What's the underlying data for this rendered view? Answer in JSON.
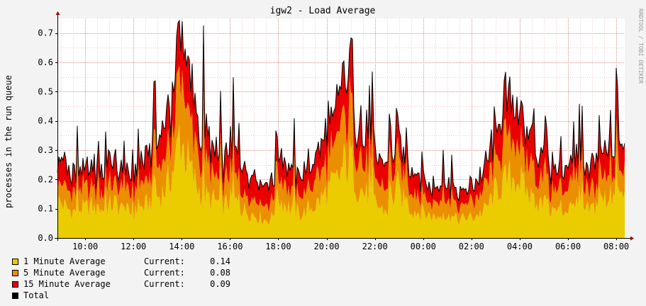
{
  "window": {
    "background": "#f3f3f3"
  },
  "chart_data": {
    "type": "area",
    "title": "igw2 - Load Average",
    "ylabel": "processes in the run queue",
    "xlabel": "",
    "watermark": "RRDTOOL / TOBI OETIKER",
    "ylim": [
      0,
      0.75
    ],
    "yticks": [
      "0.0",
      "0.1",
      "0.2",
      "0.3",
      "0.4",
      "0.5",
      "0.6",
      "0.7"
    ],
    "yticks_values": [
      0,
      0.1,
      0.2,
      0.3,
      0.4,
      0.5,
      0.6,
      0.7
    ],
    "xlim_hours": [
      8.85,
      32.35
    ],
    "xticks": [
      "10:00",
      "12:00",
      "14:00",
      "16:00",
      "18:00",
      "20:00",
      "22:00",
      "00:00",
      "02:00",
      "04:00",
      "06:00",
      "08:00"
    ],
    "xticks_hours": [
      10,
      12,
      14,
      16,
      18,
      20,
      22,
      24,
      26,
      28,
      30,
      32
    ],
    "grid": true,
    "legend_placement": "bottom-left",
    "x_hours": [
      8.85,
      9.0,
      9.25,
      9.5,
      9.75,
      10.0,
      10.25,
      10.5,
      10.75,
      11.0,
      11.25,
      11.5,
      11.75,
      12.0,
      12.25,
      12.5,
      12.75,
      13.0,
      13.25,
      13.5,
      13.75,
      13.9,
      14.0,
      14.25,
      14.5,
      14.75,
      15.0,
      15.25,
      15.5,
      15.75,
      16.0,
      16.25,
      16.5,
      16.75,
      17.0,
      17.25,
      17.5,
      17.75,
      18.0,
      18.25,
      18.5,
      18.75,
      19.0,
      19.25,
      19.5,
      19.75,
      20.0,
      20.25,
      20.5,
      20.75,
      20.9,
      21.0,
      21.25,
      21.5,
      21.75,
      22.0,
      22.25,
      22.5,
      22.75,
      22.9,
      23.0,
      23.25,
      23.5,
      23.75,
      24.0,
      24.25,
      24.5,
      24.75,
      25.0,
      25.25,
      25.5,
      25.75,
      26.0,
      26.25,
      26.5,
      26.75,
      27.0,
      27.25,
      27.5,
      27.75,
      28.0,
      28.25,
      28.5,
      28.75,
      29.0,
      29.25,
      29.5,
      29.75,
      30.0,
      30.25,
      30.5,
      30.75,
      31.0,
      31.25,
      31.5,
      31.75,
      32.0,
      32.25,
      32.35
    ],
    "series": [
      {
        "name": "1 Minute Average",
        "color": "#EACC00",
        "current": "0.14",
        "values": [
          0.13,
          0.12,
          0.1,
          0.09,
          0.1,
          0.1,
          0.11,
          0.09,
          0.1,
          0.11,
          0.12,
          0.1,
          0.09,
          0.08,
          0.1,
          0.11,
          0.13,
          0.14,
          0.16,
          0.2,
          0.26,
          0.36,
          0.33,
          0.26,
          0.2,
          0.16,
          0.14,
          0.13,
          0.12,
          0.11,
          0.13,
          0.12,
          0.1,
          0.09,
          0.08,
          0.07,
          0.06,
          0.07,
          0.14,
          0.12,
          0.1,
          0.09,
          0.08,
          0.1,
          0.11,
          0.13,
          0.16,
          0.18,
          0.2,
          0.26,
          0.25,
          0.28,
          0.18,
          0.16,
          0.14,
          0.12,
          0.1,
          0.09,
          0.12,
          0.2,
          0.15,
          0.12,
          0.1,
          0.09,
          0.08,
          0.08,
          0.07,
          0.08,
          0.07,
          0.07,
          0.06,
          0.07,
          0.07,
          0.08,
          0.09,
          0.12,
          0.16,
          0.18,
          0.2,
          0.21,
          0.2,
          0.16,
          0.14,
          0.12,
          0.11,
          0.1,
          0.09,
          0.09,
          0.1,
          0.11,
          0.1,
          0.09,
          0.1,
          0.12,
          0.13,
          0.14,
          0.14,
          0.14,
          0.14
        ]
      },
      {
        "name": "5 Minute Average",
        "color": "#EA8F00",
        "current": "0.08",
        "values": [
          0.07,
          0.07,
          0.06,
          0.06,
          0.06,
          0.07,
          0.07,
          0.06,
          0.06,
          0.07,
          0.07,
          0.06,
          0.06,
          0.06,
          0.07,
          0.07,
          0.08,
          0.09,
          0.1,
          0.12,
          0.16,
          0.2,
          0.2,
          0.17,
          0.14,
          0.11,
          0.1,
          0.09,
          0.08,
          0.08,
          0.09,
          0.08,
          0.07,
          0.06,
          0.06,
          0.06,
          0.05,
          0.06,
          0.07,
          0.07,
          0.06,
          0.06,
          0.06,
          0.07,
          0.08,
          0.09,
          0.1,
          0.12,
          0.13,
          0.17,
          0.16,
          0.18,
          0.12,
          0.1,
          0.09,
          0.08,
          0.07,
          0.07,
          0.08,
          0.1,
          0.09,
          0.08,
          0.07,
          0.06,
          0.06,
          0.05,
          0.05,
          0.05,
          0.05,
          0.05,
          0.04,
          0.05,
          0.05,
          0.06,
          0.06,
          0.08,
          0.1,
          0.12,
          0.13,
          0.14,
          0.13,
          0.11,
          0.1,
          0.08,
          0.08,
          0.07,
          0.07,
          0.07,
          0.07,
          0.08,
          0.07,
          0.07,
          0.07,
          0.08,
          0.08,
          0.08,
          0.08,
          0.08,
          0.08
        ]
      },
      {
        "name": "15 Minute Average",
        "color": "#EA0000",
        "current": "0.09",
        "values": [
          0.09,
          0.08,
          0.07,
          0.07,
          0.07,
          0.07,
          0.08,
          0.07,
          0.07,
          0.08,
          0.08,
          0.07,
          0.06,
          0.06,
          0.07,
          0.08,
          0.08,
          0.09,
          0.11,
          0.13,
          0.14,
          0.16,
          0.17,
          0.15,
          0.12,
          0.11,
          0.1,
          0.09,
          0.09,
          0.08,
          0.09,
          0.08,
          0.08,
          0.07,
          0.07,
          0.06,
          0.06,
          0.06,
          0.08,
          0.08,
          0.07,
          0.07,
          0.07,
          0.08,
          0.08,
          0.09,
          0.11,
          0.12,
          0.13,
          0.15,
          0.14,
          0.15,
          0.12,
          0.11,
          0.1,
          0.09,
          0.08,
          0.07,
          0.08,
          0.1,
          0.09,
          0.08,
          0.08,
          0.07,
          0.07,
          0.06,
          0.06,
          0.06,
          0.05,
          0.06,
          0.05,
          0.05,
          0.05,
          0.06,
          0.07,
          0.08,
          0.1,
          0.11,
          0.12,
          0.12,
          0.12,
          0.11,
          0.1,
          0.09,
          0.08,
          0.08,
          0.07,
          0.07,
          0.07,
          0.08,
          0.07,
          0.07,
          0.08,
          0.08,
          0.09,
          0.09,
          0.09,
          0.09,
          0.09
        ]
      },
      {
        "name": "Total",
        "color": "#000000",
        "current": ""
      }
    ],
    "legend": [
      {
        "name": "1 Minute Average",
        "current_label": "Current:",
        "current": "0.14",
        "color": "#EACC00"
      },
      {
        "name": "5 Minute Average",
        "current_label": "Current:",
        "current": "0.08",
        "color": "#EA8F00"
      },
      {
        "name": "15 Minute Average",
        "current_label": "Current:",
        "current": "0.09",
        "color": "#EA0000"
      },
      {
        "name": "Total",
        "current_label": "",
        "current": "",
        "color": "#000000"
      }
    ]
  }
}
